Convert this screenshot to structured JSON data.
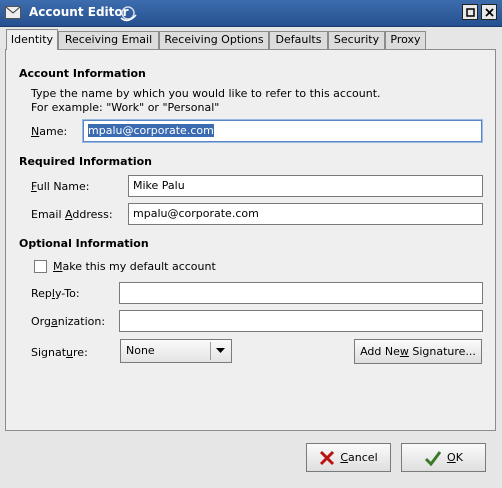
{
  "window": {
    "title": "Account Editor"
  },
  "tabs": [
    "Identity",
    "Receiving Email",
    "Receiving Options",
    "Defaults",
    "Security",
    "Proxy"
  ],
  "account_info": {
    "heading": "Account Information",
    "desc1": "Type the name by which you would like to refer to this account.",
    "desc2": "For example: \"Work\" or \"Personal\"",
    "name_label": "ame:",
    "name_label_u": "N",
    "name_value": "mpalu@corporate.com"
  },
  "required_info": {
    "heading": "Required Information",
    "full_name_label_u": "F",
    "full_name_label": "ull Name:",
    "full_name_value": "Mike Palu",
    "email_label_a": "Email ",
    "email_label_u": "A",
    "email_label_b": "ddress:",
    "email_value": "mpalu@corporate.com"
  },
  "optional_info": {
    "heading": "Optional Information",
    "default_u": "M",
    "default_label": "ake this my default account",
    "reply_a": "Rep",
    "reply_u": "l",
    "reply_b": "y-To:",
    "org_a": "Org",
    "org_u": "a",
    "org_b": "nization:",
    "sig_a": "Signat",
    "sig_u": "u",
    "sig_b": "re:",
    "signature_value": "None",
    "add_sig_a": "Add Ne",
    "add_sig_u": "w",
    "add_sig_b": " Signature..."
  },
  "buttons": {
    "cancel_u": "C",
    "cancel": "ancel",
    "ok_u": "O",
    "ok": "K"
  }
}
